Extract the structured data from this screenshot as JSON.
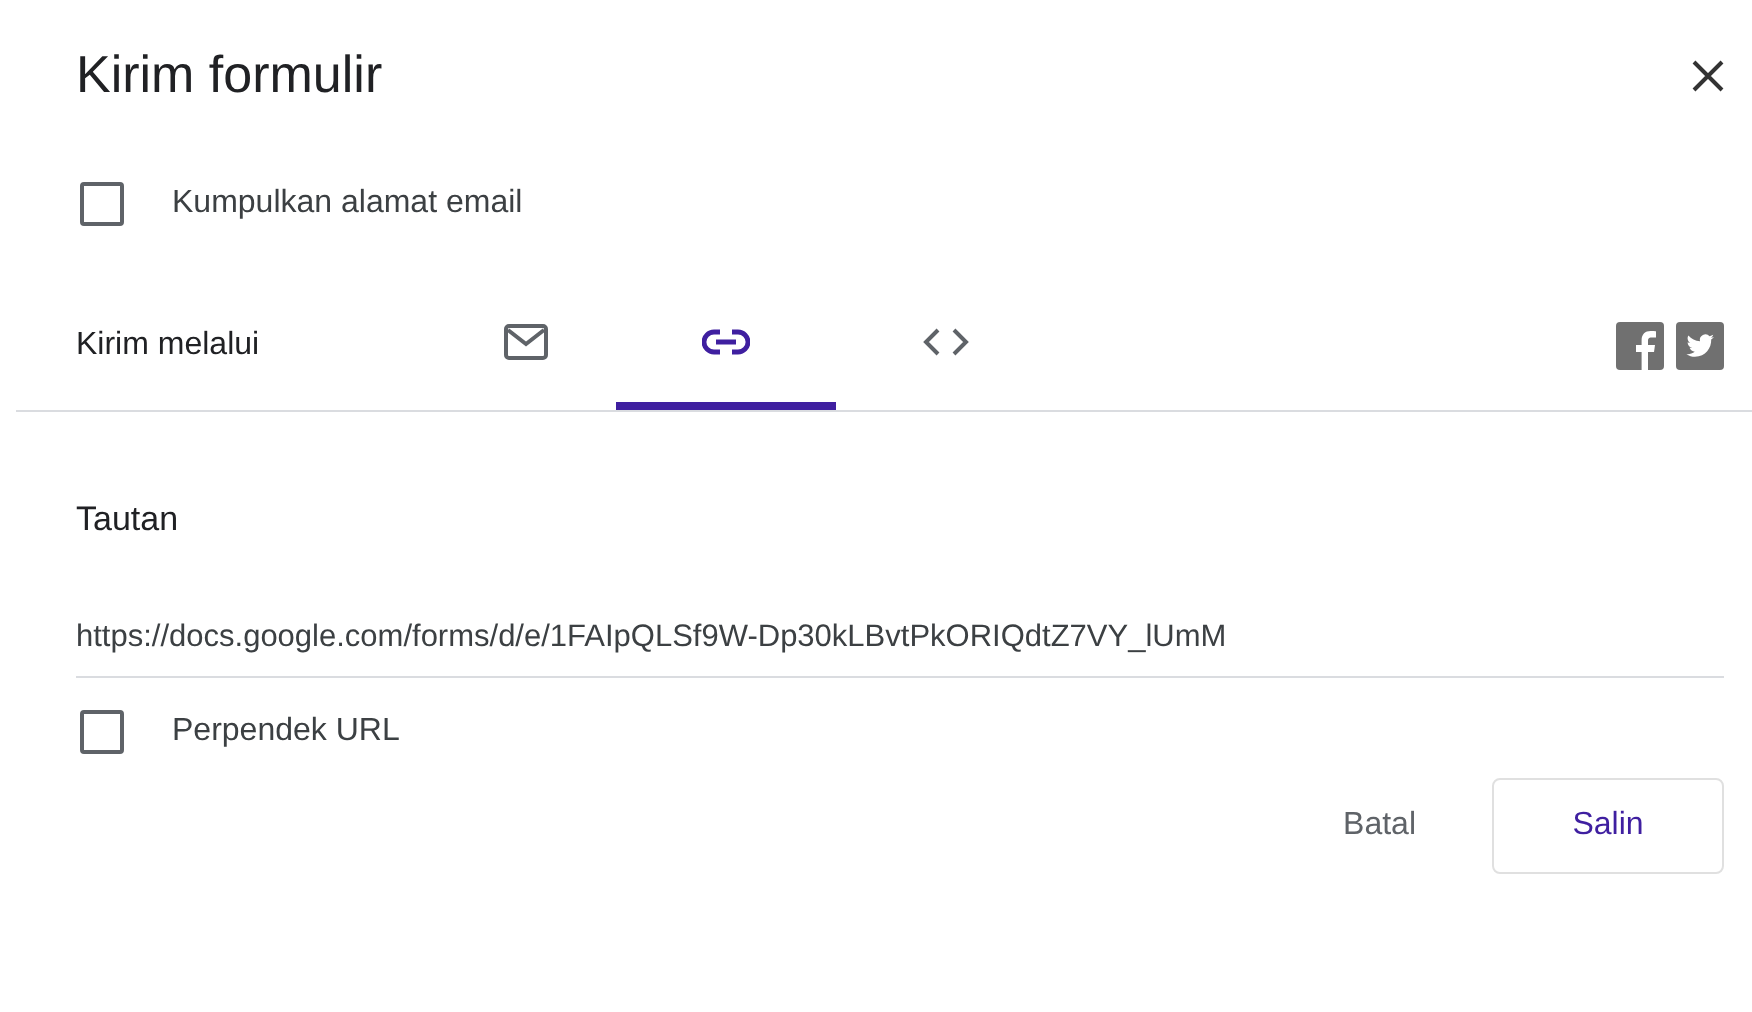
{
  "dialog": {
    "title": "Kirim formulir"
  },
  "collect_email": {
    "label": "Kumpulkan alamat email",
    "checked": false
  },
  "send_via": {
    "label": "Kirim melalui",
    "tabs": [
      {
        "kind": "mail",
        "selected": false
      },
      {
        "kind": "link",
        "selected": true
      },
      {
        "kind": "code",
        "selected": false
      }
    ],
    "share": [
      {
        "kind": "facebook"
      },
      {
        "kind": "twitter"
      }
    ]
  },
  "link": {
    "heading": "Tautan",
    "value": "https://docs.google.com/forms/d/e/1FAIpQLSf9W-Dp30kLBvtPkORIQdtZ7VY_lUmM"
  },
  "shorten": {
    "label": "Perpendek URL",
    "checked": false
  },
  "buttons": [
    {
      "label": "Batal",
      "kind": "text"
    },
    {
      "label": "Salin",
      "kind": "outlined"
    }
  ]
}
